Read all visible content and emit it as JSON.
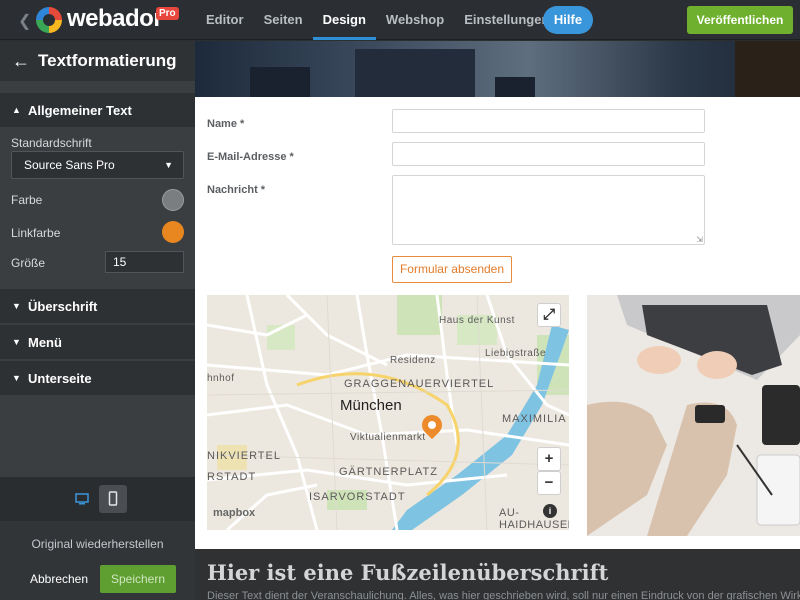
{
  "app": {
    "logo_text": "webador",
    "pro_badge": "Pro"
  },
  "nav": {
    "items": [
      "Editor",
      "Seiten",
      "Design",
      "Webshop",
      "Einstellungen"
    ],
    "active": "Design",
    "help_label": "Hilfe",
    "publish_label": "Veröffentlichen"
  },
  "sidebar": {
    "title": "Textformatierung",
    "sections": {
      "general": "Allgemeiner Text",
      "heading": "Überschrift",
      "menu": "Menü",
      "subpage": "Unterseite"
    },
    "standard_font_label": "Standardschrift",
    "standard_font_value": "Source Sans Pro",
    "color_label": "Farbe",
    "color_value": "#7b7e81",
    "link_color_label": "Linkfarbe",
    "link_color_value": "#e8861f",
    "size_label": "Größe",
    "size_value": "15",
    "restore_label": "Original wiederherstellen",
    "cancel_label": "Abbrechen",
    "save_label": "Speichern"
  },
  "form": {
    "name_label": "Name *",
    "email_label": "E-Mail-Adresse *",
    "message_label": "Nachricht *",
    "submit_label": "Formular absenden"
  },
  "map": {
    "city": "München",
    "labels": [
      "Haus der Kunst",
      "Residenz",
      "Liebigstraße",
      "GRAGGENAUERVIERTEL",
      "MAXIMILIA",
      "Viktualienmarkt",
      "GÄRTNERPLATZ",
      "ISARVORSTADT",
      "NIKVIERTEL",
      "RSTADT",
      "hnhof",
      "AU-",
      "HAIDHAUSEN"
    ],
    "zoom_in": "+",
    "zoom_out": "−",
    "attribution": "mapbox",
    "info": "i"
  },
  "footer": {
    "title": "Hier ist eine Fußzeilenüberschrift",
    "text": "Dieser Text dient der Veranschaulichung. Alles, was hier geschrieben wird, soll nur einen Eindruck von der grafischen Wirkung des T"
  },
  "colors": {
    "accent_blue": "#2e8fd6",
    "publish_green": "#6fb12f",
    "orange": "#e8861f"
  }
}
